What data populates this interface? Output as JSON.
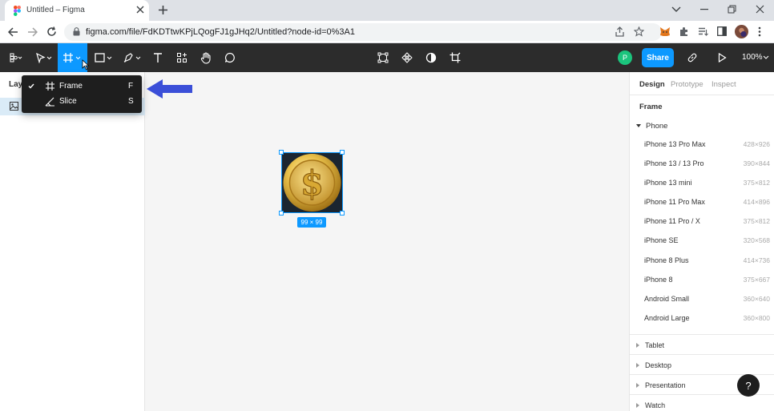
{
  "browser": {
    "tab_title": "Untitled – Figma",
    "url": "figma.com/file/FdKDTtwKPjLQogFJ1gJHq2/Untitled?node-id=0%3A1"
  },
  "toolbar": {
    "avatar_initial": "P",
    "share_label": "Share",
    "zoom_label": "100%"
  },
  "left_panel": {
    "layers_label": "Lay"
  },
  "dropdown": {
    "items": [
      {
        "label": "Frame",
        "shortcut": "F",
        "checked": true
      },
      {
        "label": "Slice",
        "shortcut": "S",
        "checked": false
      }
    ]
  },
  "canvas": {
    "size_badge": "99 × 99"
  },
  "right_panel": {
    "tabs": [
      "Design",
      "Prototype",
      "Inspect"
    ],
    "section_title": "Frame",
    "phone_label": "Phone",
    "devices": [
      {
        "name": "iPhone 13 Pro Max",
        "size": "428×926"
      },
      {
        "name": "iPhone 13 / 13 Pro",
        "size": "390×844"
      },
      {
        "name": "iPhone 13 mini",
        "size": "375×812"
      },
      {
        "name": "iPhone 11 Pro Max",
        "size": "414×896"
      },
      {
        "name": "iPhone 11 Pro / X",
        "size": "375×812"
      },
      {
        "name": "iPhone SE",
        "size": "320×568"
      },
      {
        "name": "iPhone 8 Plus",
        "size": "414×736"
      },
      {
        "name": "iPhone 8",
        "size": "375×667"
      },
      {
        "name": "Android Small",
        "size": "360×640"
      },
      {
        "name": "Android Large",
        "size": "360×800"
      }
    ],
    "categories": [
      "Tablet",
      "Desktop",
      "Presentation",
      "Watch"
    ]
  },
  "help_label": "?",
  "colors": {
    "accent": "#0d99ff",
    "toolbar_bg": "#2c2c2c",
    "arrow": "#3b4fd8"
  }
}
